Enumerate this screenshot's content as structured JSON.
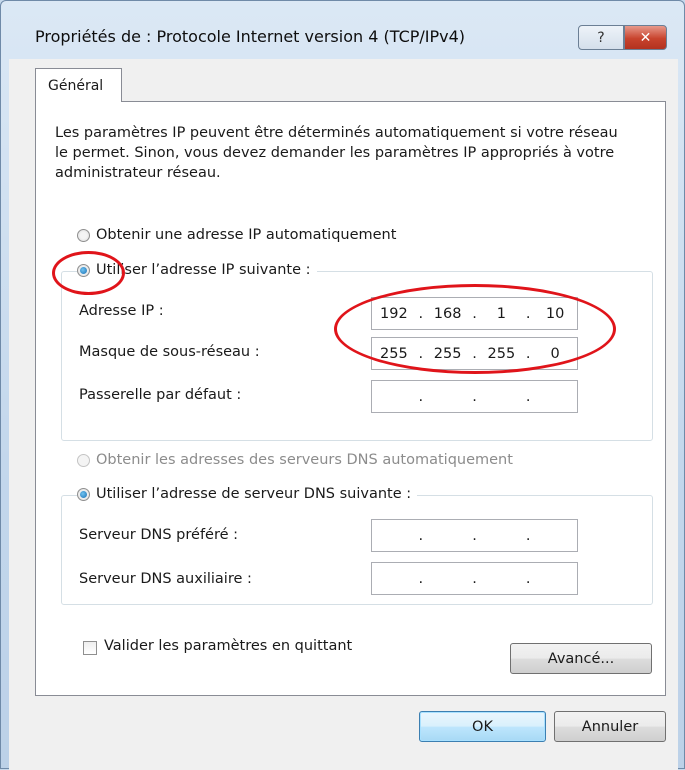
{
  "window": {
    "title": "Propriétés de : Protocole Internet version 4 (TCP/IPv4)",
    "help_label": "?",
    "close_label": "✕"
  },
  "tabs": [
    "Général"
  ],
  "description": "Les paramètres IP peuvent être déterminés automatiquement si votre réseau le permet. Sinon, vous devez demander les paramètres IP appropriés à votre administrateur réseau.",
  "ip_section": {
    "auto_label": "Obtenir une adresse IP automatiquement",
    "manual_label": "Utiliser l’adresse IP suivante :",
    "selected": "manual",
    "fields": [
      {
        "label": "Adresse IP :",
        "octets": [
          "192",
          "168",
          "1",
          "10"
        ]
      },
      {
        "label": "Masque de sous-réseau :",
        "octets": [
          "255",
          "255",
          "255",
          "0"
        ]
      },
      {
        "label": "Passerelle par défaut :",
        "octets": [
          "",
          "",
          "",
          ""
        ]
      }
    ]
  },
  "dns_section": {
    "auto_label": "Obtenir les adresses des serveurs DNS automatiquement",
    "manual_label": "Utiliser l’adresse de serveur DNS suivante :",
    "selected": "manual",
    "fields": [
      {
        "label": "Serveur DNS préféré :",
        "octets": [
          "",
          "",
          "",
          ""
        ]
      },
      {
        "label": "Serveur DNS auxiliaire :",
        "octets": [
          "",
          "",
          "",
          ""
        ]
      }
    ]
  },
  "validate_label": "Valider les paramètres en quittant",
  "validate_checked": false,
  "buttons": {
    "advanced": "Avancé...",
    "ok": "OK",
    "cancel": "Annuler"
  },
  "colors": {
    "annotation": "#e0141a",
    "close_button": "#c8432d"
  }
}
